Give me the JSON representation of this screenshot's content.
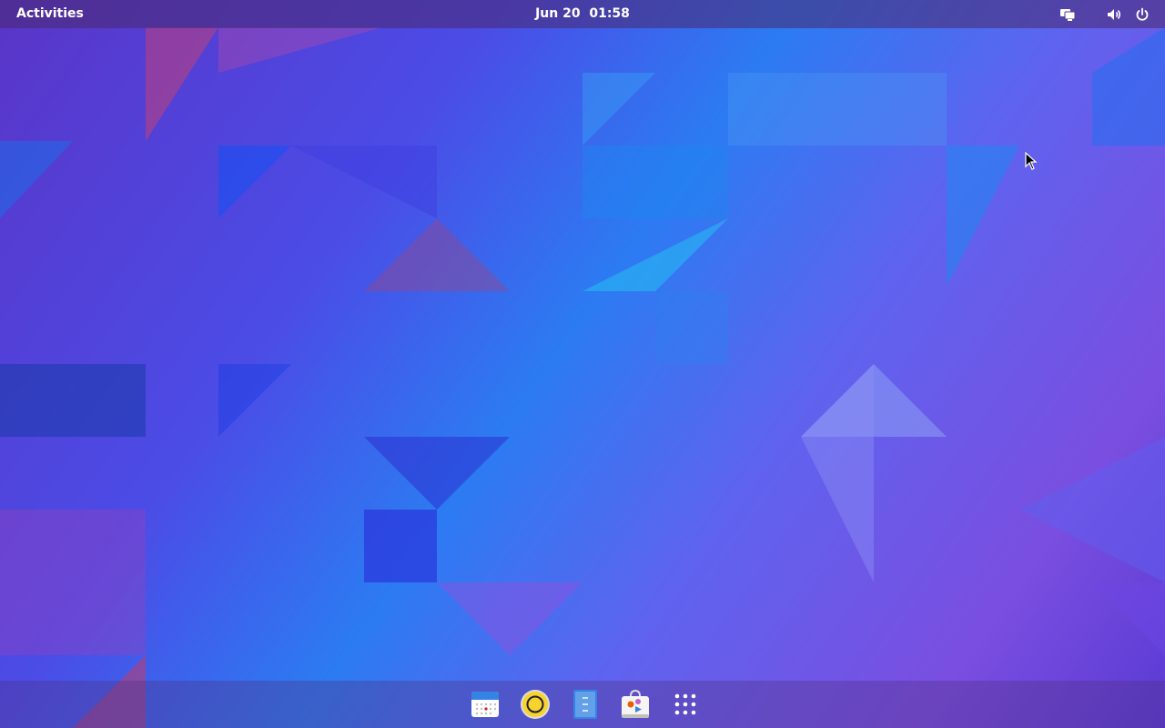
{
  "top_bar": {
    "activities_label": "Activities",
    "clock_text": "Jun 20  01:58",
    "indicators": [
      "display-icon",
      "volume-icon",
      "power-icon"
    ]
  },
  "dock": {
    "items": [
      {
        "name": "calendar-icon"
      },
      {
        "name": "rhythmbox-icon"
      },
      {
        "name": "text-editor-icon"
      },
      {
        "name": "software-store-icon"
      },
      {
        "name": "show-applications-icon"
      }
    ]
  },
  "colors": {
    "top_bar": "#48286e",
    "wallpaper_primary": "#4b4ce6",
    "wallpaper_accent": "#2c7bf2"
  }
}
